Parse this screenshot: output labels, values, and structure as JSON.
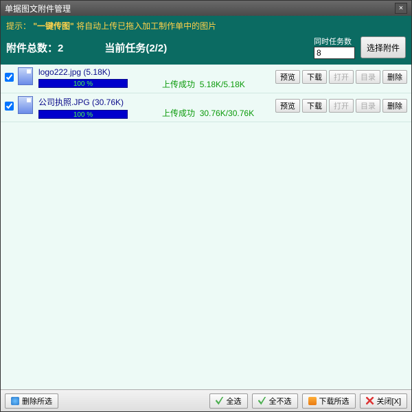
{
  "window": {
    "title": "单据图文附件管理",
    "close": "×"
  },
  "header": {
    "hint_prefix": "提示：",
    "hint_bold": "\"一键传图\"",
    "hint_rest": " 将自动上传已拖入加工制作单中的图片",
    "total_label": "附件总数：2",
    "current_task": "当前任务(2/2)",
    "concurrent_label": "同时任务数",
    "concurrent_value": "8",
    "select_file": "选择附件"
  },
  "rows": [
    {
      "checked": true,
      "filename": "logo222.jpg (5.18K)",
      "progress_pct": "100 %",
      "progress_width": "100%",
      "status": "上传成功",
      "size": "5.18K/5.18K"
    },
    {
      "checked": true,
      "filename": "公司执照.JPG (30.76K)",
      "progress_pct": "100 %",
      "progress_width": "100%",
      "status": "上传成功",
      "size": "30.76K/30.76K"
    }
  ],
  "rowbtns": {
    "preview": "预览",
    "download": "下载",
    "open": "打开",
    "catalog": "目录",
    "delete": "删除"
  },
  "footer": {
    "delete_selected": "删除所选",
    "select_all": "全选",
    "select_none": "全不选",
    "download_selected": "下载所选",
    "close": "关闭[X]"
  }
}
